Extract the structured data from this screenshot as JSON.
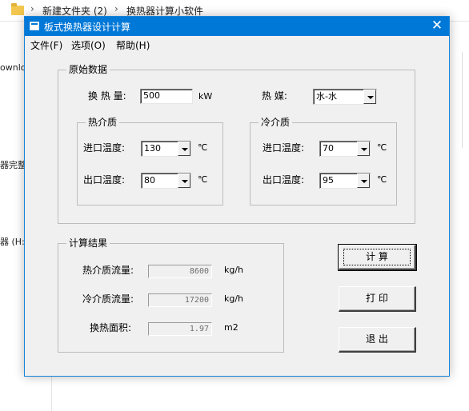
{
  "explorer": {
    "breadcrumb": [
      "新建文件夹 (2)",
      "换热器计算小软件"
    ],
    "sidebar_fragments": [
      "ownlo",
      "器完整",
      "器 (H:)"
    ]
  },
  "window": {
    "title": "板式换热器设计计算",
    "close_glyph": "✕"
  },
  "menu": [
    "文件(F)",
    "选项(O)",
    "帮助(H)"
  ],
  "input_group": {
    "title": "原始数据",
    "heat_label": "换 热 量:",
    "heat_value": "500",
    "heat_unit": "kW",
    "medium_label": "热    媒:",
    "medium_value": "水-水",
    "hot": {
      "title": "热介质",
      "inlet_label": "进口温度:",
      "inlet_value": "130",
      "outlet_label": "出口温度:",
      "outlet_value": "80",
      "unit": "℃"
    },
    "cold": {
      "title": "冷介质",
      "inlet_label": "进口温度:",
      "inlet_value": "70",
      "outlet_label": "出口温度:",
      "outlet_value": "95",
      "unit": "℃"
    }
  },
  "result_group": {
    "title": "计算结果",
    "hot_flow_label": "热介质流量:",
    "hot_flow_value": "8600",
    "hot_flow_unit": "kg/h",
    "cold_flow_label": "冷介质流量:",
    "cold_flow_value": "17200",
    "cold_flow_unit": "kg/h",
    "area_label": "换热面积:",
    "area_value": "1.97",
    "area_unit": "m2"
  },
  "buttons": {
    "calculate": "计  算",
    "print": "打  印",
    "exit": "退  出"
  },
  "colors": {
    "titlebar": "#0078d7",
    "window_bg": "#f0f0f0"
  }
}
